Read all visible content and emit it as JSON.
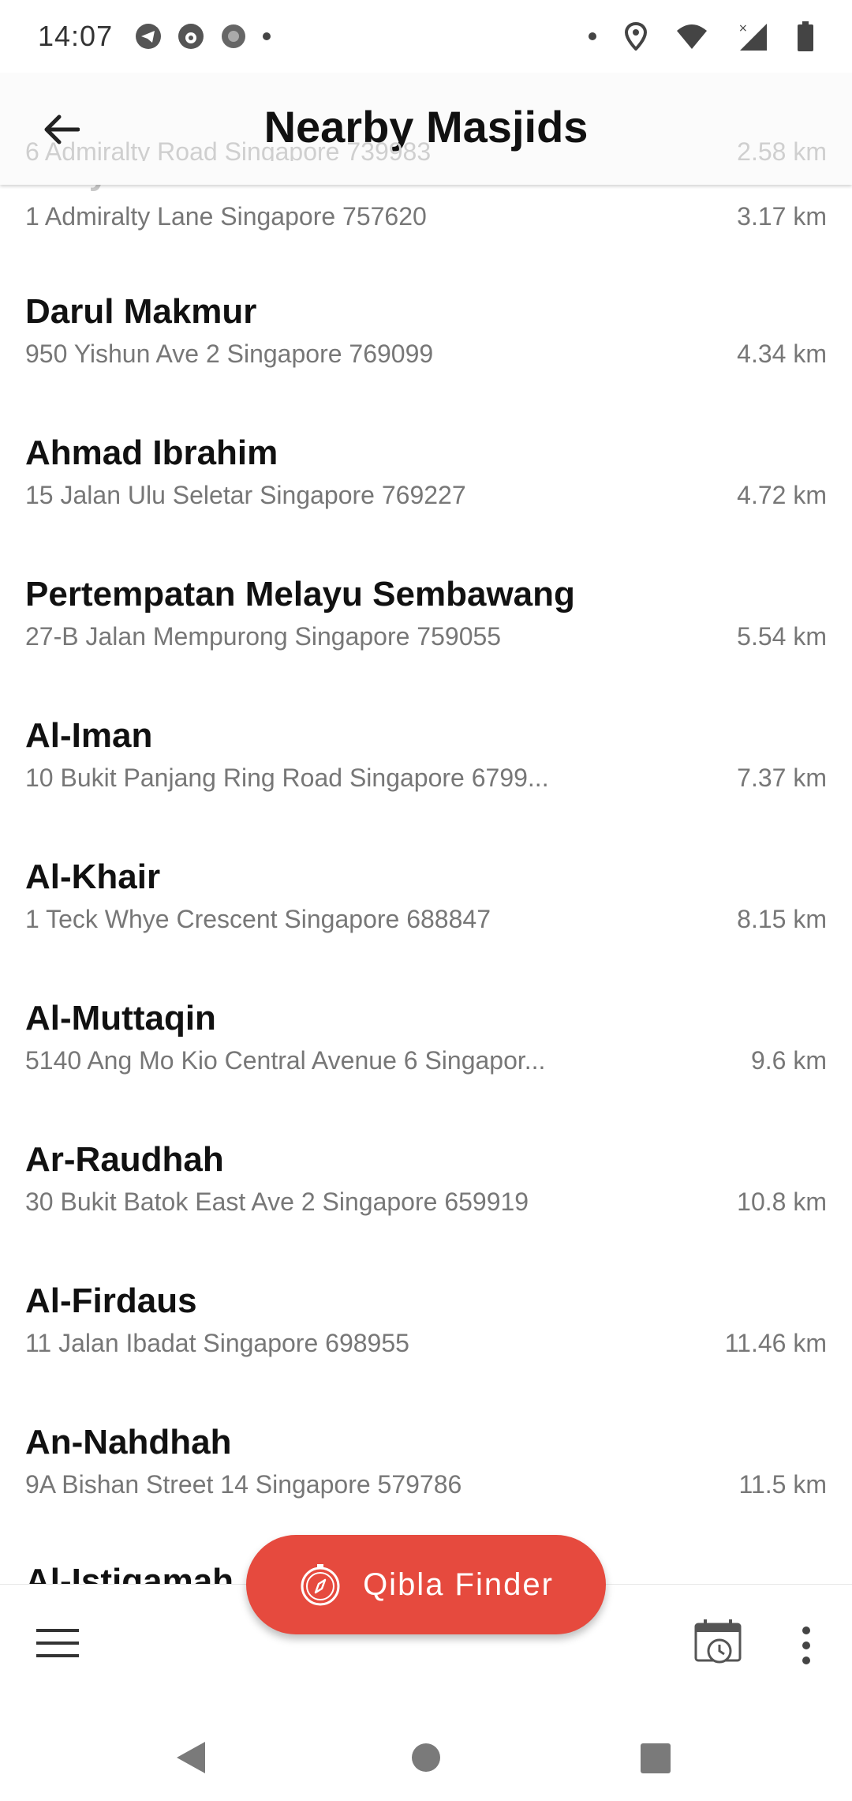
{
  "status_bar": {
    "time": "14:07"
  },
  "app_bar": {
    "title": "Nearby Masjids"
  },
  "ghost": {
    "address": "6 Admiralty Road Singapore 739983",
    "distance": "2.58 km",
    "name": "Assyafaah"
  },
  "masjids": [
    {
      "name": "",
      "address": "1 Admiralty Lane Singapore 757620",
      "distance": "3.17 km"
    },
    {
      "name": "Darul Makmur",
      "address": "950 Yishun Ave 2 Singapore 769099",
      "distance": "4.34 km"
    },
    {
      "name": "Ahmad Ibrahim",
      "address": "15 Jalan Ulu Seletar Singapore 769227",
      "distance": "4.72 km"
    },
    {
      "name": "Pertempatan Melayu Sembawang",
      "address": "27-B Jalan Mempurong Singapore 759055",
      "distance": "5.54 km"
    },
    {
      "name": "Al-Iman",
      "address": "10 Bukit Panjang Ring Road Singapore 6799...",
      "distance": "7.37 km"
    },
    {
      "name": "Al-Khair",
      "address": "1 Teck Whye Crescent Singapore 688847",
      "distance": "8.15 km"
    },
    {
      "name": "Al-Muttaqin",
      "address": "5140 Ang Mo Kio Central Avenue 6 Singapor...",
      "distance": "9.6 km"
    },
    {
      "name": "Ar-Raudhah",
      "address": "30 Bukit Batok East Ave 2 Singapore 659919",
      "distance": "10.8 km"
    },
    {
      "name": "Al-Firdaus",
      "address": "11 Jalan Ibadat Singapore 698955",
      "distance": "11.46 km"
    },
    {
      "name": "An-Nahdhah",
      "address": "9A Bishan Street 14 Singapore 579786",
      "distance": "11.5 km"
    },
    {
      "name": "Al-Istiqamah",
      "address": "",
      "distance": ""
    }
  ],
  "fab": {
    "label": "Qibla Finder"
  },
  "icons": [
    "back-arrow-icon",
    "menu-icon",
    "calendar-clock-icon",
    "more-vert-icon",
    "compass-icon"
  ],
  "colors": {
    "accent": "#e64a3e",
    "text_primary": "#111111",
    "text_secondary": "#777777"
  }
}
